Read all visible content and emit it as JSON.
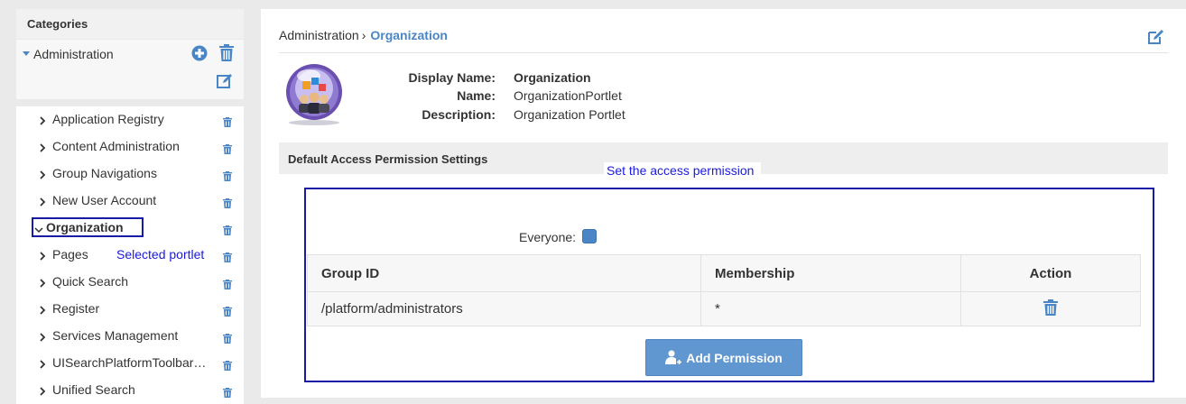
{
  "left": {
    "header": "Categories",
    "root_label": "Administration",
    "items": [
      {
        "label": "Application Registry"
      },
      {
        "label": "Content Administration"
      },
      {
        "label": "Group Navigations"
      },
      {
        "label": "New User Account"
      },
      {
        "label": "Organization"
      },
      {
        "label": "Pages"
      },
      {
        "label": "Quick Search"
      },
      {
        "label": "Register"
      },
      {
        "label": "Services Management"
      },
      {
        "label": "UISearchPlatformToolbarPortlet"
      },
      {
        "label": "Unified Search"
      }
    ],
    "selected_annotation": "Selected portlet"
  },
  "main": {
    "breadcrumb_parent": "Administration",
    "breadcrumb_sep": "›",
    "breadcrumb_current": "Organization",
    "info": {
      "display_name_key": "Display Name:",
      "display_name_val": "Organization",
      "name_key": "Name:",
      "name_val": "OrganizationPortlet",
      "description_key": "Description:",
      "description_val": "Organization Portlet"
    },
    "section_title": "Default Access Permission Settings",
    "access_annotation": "Set the access permission",
    "everyone_label": "Everyone:",
    "table": {
      "headers": [
        "Group ID",
        "Membership",
        "Action"
      ],
      "rows": [
        {
          "group_id": "/platform/administrators",
          "membership": "*"
        }
      ]
    },
    "add_button": "Add Permission"
  },
  "colors": {
    "accent": "#4a86c5",
    "annotation": "#1a1aa8",
    "button": "#6197d1"
  }
}
